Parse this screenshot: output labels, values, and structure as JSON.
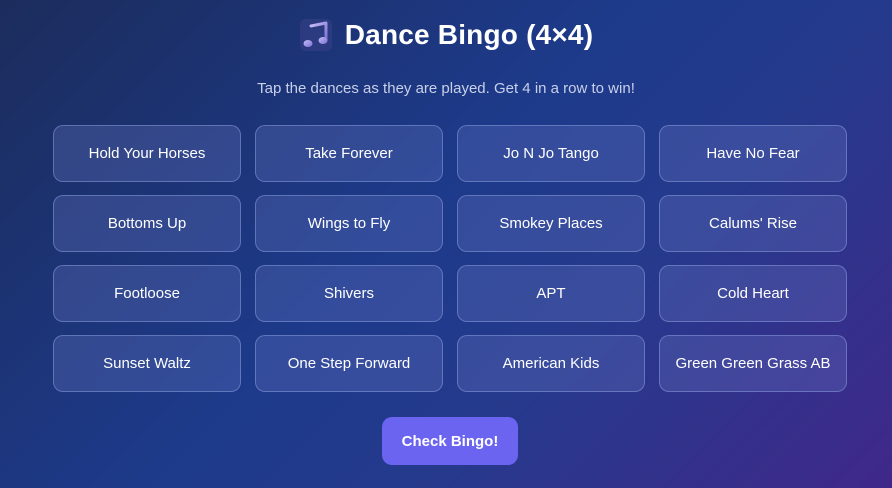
{
  "header": {
    "icon": "music-note-icon",
    "title": "Dance Bingo (4×4)",
    "subtitle": "Tap the dances as they are played. Get 4 in a row to win!"
  },
  "board": {
    "cells": [
      "Hold Your Horses",
      "Take Forever",
      "Jo N Jo Tango",
      "Have No Fear",
      "Bottoms Up",
      "Wings to Fly",
      "Smokey Places",
      "Calums' Rise",
      "Footloose",
      "Shivers",
      "APT",
      "Cold Heart",
      "Sunset Waltz",
      "One Step Forward",
      "American Kids",
      "Green Green Grass AB"
    ]
  },
  "actions": {
    "check_label": "Check Bingo!"
  },
  "colors": {
    "accent": "#6a64f1",
    "icon_gradient_start": "#b9b2f0",
    "icon_gradient_end": "#7b72d6"
  }
}
